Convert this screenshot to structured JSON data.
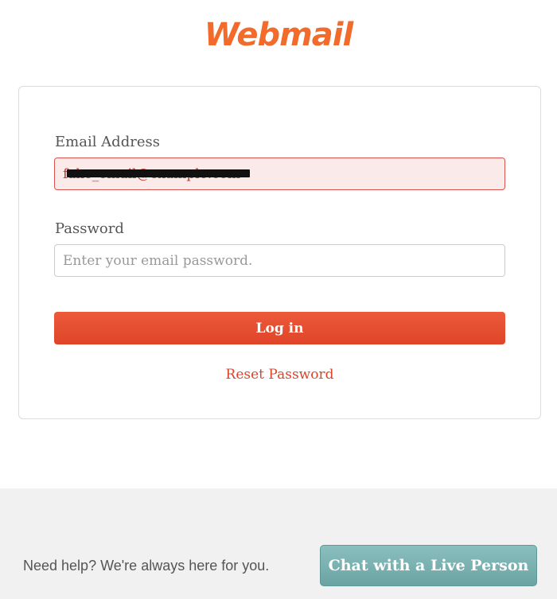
{
  "brand": {
    "logo_text": "Webmail",
    "accent": "#f26b2a"
  },
  "login": {
    "email_label": "Email Address",
    "email_value": "fake_email@example.com",
    "password_label": "Password",
    "password_placeholder": "Enter your email password.",
    "login_button": "Log in",
    "reset_link": "Reset Password"
  },
  "footer": {
    "help_text": "Need help? We're always here for you.",
    "chat_button": "Chat with a Live Person"
  }
}
